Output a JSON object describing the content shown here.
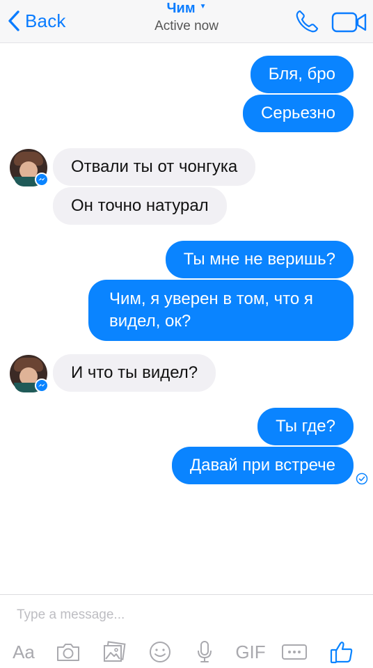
{
  "header": {
    "back_label": "Back",
    "title": "Чим",
    "subtitle": "Active now"
  },
  "messages": [
    {
      "direction": "outgoing",
      "text": "Бля, бро"
    },
    {
      "direction": "outgoing",
      "text": "Серьезно"
    },
    {
      "direction": "incoming",
      "text": "Отвали ты от чонгука"
    },
    {
      "direction": "incoming",
      "text": "Он точно натурал"
    },
    {
      "direction": "outgoing",
      "text": "Ты мне не веришь?"
    },
    {
      "direction": "outgoing",
      "text": "Чим, я уверен в том, что я видел, ок?"
    },
    {
      "direction": "incoming",
      "text": "И что ты видел?"
    },
    {
      "direction": "outgoing",
      "text": "Ты где?"
    },
    {
      "direction": "outgoing",
      "text": "Давай при встрече"
    }
  ],
  "composer": {
    "placeholder": "Type a message...",
    "text_tool_label": "Aa",
    "gif_label": "GIF"
  },
  "icons": [
    "back-chevron-icon",
    "phone-icon",
    "video-camera-icon",
    "messenger-badge-icon",
    "seen-check-icon",
    "camera-icon",
    "gallery-icon",
    "emoji-icon",
    "microphone-icon",
    "more-icon",
    "thumbs-up-icon"
  ],
  "colors": {
    "accent": "#0a84ff",
    "incoming_bubble": "#f1f0f4",
    "icon_gray": "#a9a9ae"
  }
}
